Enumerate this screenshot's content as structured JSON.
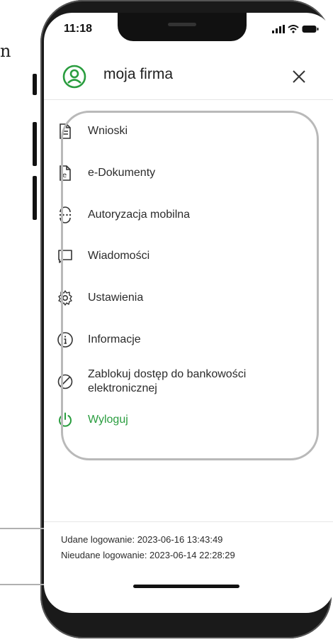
{
  "page_fragment": "n",
  "status": {
    "time": "11:18"
  },
  "header": {
    "title": "moja firma"
  },
  "menu": {
    "items": [
      {
        "label": "Wnioski",
        "icon": "document-icon"
      },
      {
        "label": "e-Dokumenty",
        "icon": "e-document-icon"
      },
      {
        "label": "Autoryzacja mobilna",
        "icon": "mobile-authorization-icon"
      },
      {
        "label": "Wiadomości",
        "icon": "message-icon"
      },
      {
        "label": "Ustawienia",
        "icon": "gear-icon"
      },
      {
        "label": "Informacje",
        "icon": "info-icon"
      },
      {
        "label": "Zablokuj dostęp do bankowości elektronicznej",
        "line1": "Zablokuj dostęp do bankowości",
        "line2": "elektronicznej",
        "icon": "block-icon"
      },
      {
        "label": "Wyloguj",
        "icon": "power-icon"
      }
    ]
  },
  "footer": {
    "successful_login": "Udane logowanie: 2023-06-16 13:43:49",
    "failed_login": "Nieudane logowanie: 2023-06-14 22:28:29"
  },
  "colors": {
    "accent": "#2a9d3f",
    "text": "#2b2b2b"
  }
}
